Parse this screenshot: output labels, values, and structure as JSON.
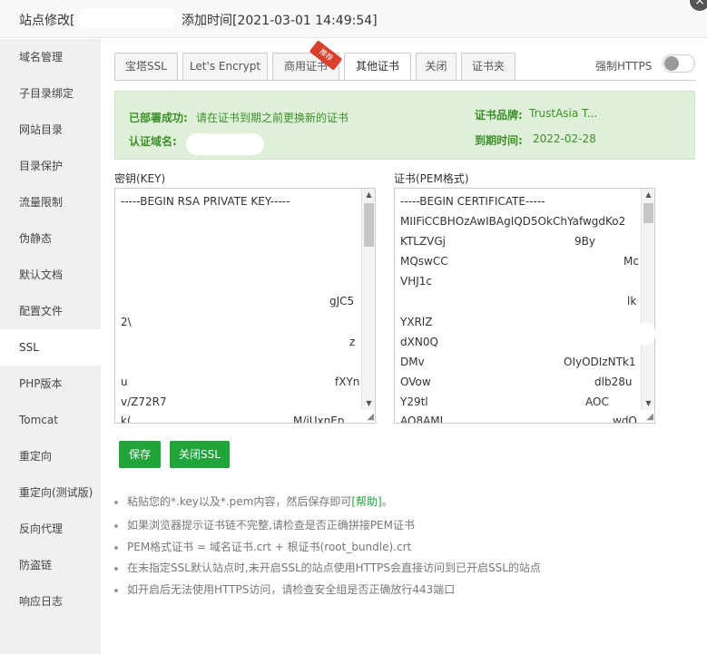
{
  "title": {
    "prefix": "站点修改[",
    "added": "添加时间[2021-03-01 14:49:54]"
  },
  "close_label": "×",
  "sidebar": {
    "items": [
      {
        "label": "域名管理"
      },
      {
        "label": "子目录绑定"
      },
      {
        "label": "网站目录"
      },
      {
        "label": "目录保护"
      },
      {
        "label": "流量限制"
      },
      {
        "label": "伪静态"
      },
      {
        "label": "默认文档"
      },
      {
        "label": "配置文件"
      },
      {
        "label": "SSL"
      },
      {
        "label": "PHP版本"
      },
      {
        "label": "Tomcat"
      },
      {
        "label": "重定向"
      },
      {
        "label": "重定向(测试版)"
      },
      {
        "label": "反向代理"
      },
      {
        "label": "防盗链"
      },
      {
        "label": "响应日志"
      }
    ],
    "active_index": 8
  },
  "tabs": [
    {
      "label": "宝塔SSL"
    },
    {
      "label": "Let's Encrypt"
    },
    {
      "label": "商用证书"
    },
    {
      "label": "其他证书"
    },
    {
      "label": "关闭"
    },
    {
      "label": "证书夹"
    }
  ],
  "tab_badge": "推荐",
  "force_https": {
    "label": "强制HTTPS",
    "enabled": false
  },
  "status": {
    "deployed_label": "已部署成功:",
    "deployed_text": "请在证书到期之前更换新的证书",
    "domain_label": "认证域名:",
    "brand_label": "证书品牌:",
    "brand_value": "TrustAsia T...",
    "expire_label": "到期时间:",
    "expire_value": "2022-02-28"
  },
  "key_field": {
    "label": "密钥(KEY)",
    "lines": [
      "-----BEGIN RSA PRIVATE KEY-----",
      "gJC5",
      "2\\",
      "z",
      "u",
      "fXYn",
      "v/Z72R7",
      "k(",
      "M/iUxnEp"
    ]
  },
  "cert_field": {
    "label": "证书(PEM格式)",
    "lines": [
      "-----BEGIN CERTIFICATE-----",
      "MIIFiCCBHOzAwIBAgIQD5OkChYafwgdKo2",
      "KTLZVGj",
      "9By",
      "MQswCC",
      "Mc",
      "VHJ1c",
      "lk",
      "YXRlZ",
      "dXN0Q",
      "DMv",
      "OIyODIzNTk1",
      "OVow",
      "dlb28u",
      "Y29tl",
      "AOC",
      "AQ8AMI",
      "wdO"
    ]
  },
  "buttons": {
    "save": "保存",
    "close_ssl": "关闭SSL"
  },
  "tips": [
    {
      "text": "粘贴您的*.key以及*.pem内容，然后保存即可",
      "link": "[帮助]",
      "suffix": "。"
    },
    {
      "text": "如果浏览器提示证书链不完整,请检查是否正确拼接PEM证书"
    },
    {
      "text": "PEM格式证书 = 域名证书.crt + 根证书(root_bundle).crt"
    },
    {
      "text": "在未指定SSL默认站点时,未开启SSL的站点使用HTTPS会直接访问到已开启SSL的站点"
    },
    {
      "text": "如开启后无法使用HTTPS访问，请检查安全组是否正确放行443端口"
    }
  ],
  "colors": {
    "accent": "#20a53a",
    "badge": "#d9402c",
    "status_bg": "#dff0d8",
    "status_text": "#3c8f2a"
  }
}
